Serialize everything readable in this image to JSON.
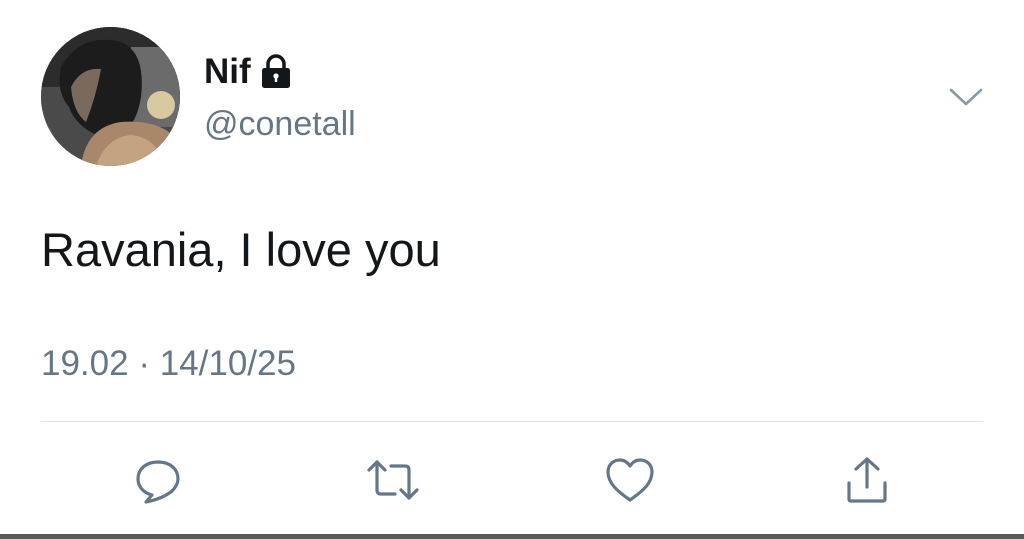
{
  "user": {
    "display_name": "Nif",
    "handle": "@conetall",
    "protected_icon": "lock-icon",
    "avatar": "profile-photo"
  },
  "tweet": {
    "text": "Ravania, I love you",
    "time": "19.02",
    "separator": " · ",
    "date": "14/10/25"
  },
  "actions": [
    {
      "name": "reply",
      "icon": "comment-icon"
    },
    {
      "name": "retweet",
      "icon": "retweet-icon"
    },
    {
      "name": "like",
      "icon": "heart-icon"
    },
    {
      "name": "share",
      "icon": "share-icon"
    }
  ],
  "menu": {
    "icon": "chevron-down-icon"
  },
  "colors": {
    "text": "#14171a",
    "secondary": "#657786",
    "icon": "#657786",
    "divider": "#dfe3e6"
  }
}
